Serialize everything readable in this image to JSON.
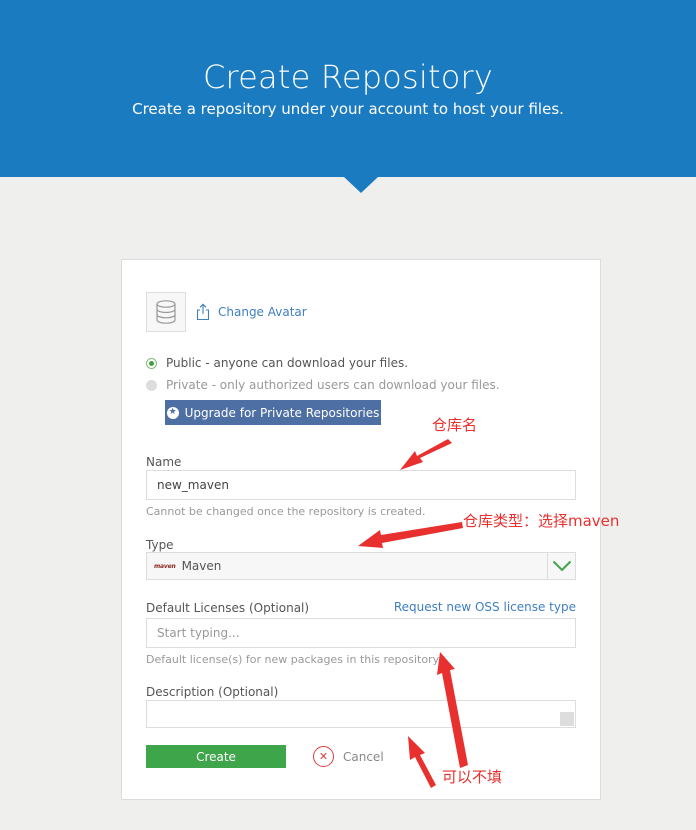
{
  "hero": {
    "title": "Create Repository",
    "subtitle": "Create a repository under your account to host your files."
  },
  "avatar": {
    "change_label": "Change Avatar"
  },
  "visibility": {
    "public_label": "Public - anyone can download your files.",
    "private_label": "Private - only authorized users can download your files.",
    "selected": "public",
    "upgrade_label": "Upgrade for Private Repositories"
  },
  "form": {
    "name_label": "Name",
    "name_value": "new_maven",
    "name_help": "Cannot be changed once the repository is created.",
    "type_label": "Type",
    "type_logo_text": "maven",
    "type_value": "Maven",
    "licenses_label": "Default Licenses (Optional)",
    "licenses_link": "Request new OSS license type",
    "licenses_placeholder": "Start typing...",
    "licenses_help": "Default license(s) for new packages in this repository.",
    "description_label": "Description (Optional)",
    "description_value": ""
  },
  "actions": {
    "create_label": "Create",
    "cancel_label": "Cancel"
  },
  "annotations": {
    "repo_name": "仓库名",
    "repo_type": "仓库类型：选择maven",
    "optional": "可以不填"
  },
  "colors": {
    "header_blue": "#1b7bc1",
    "create_green": "#3ea54a",
    "upgrade_blue": "#4e6fa3",
    "annotation_red": "#e8312f",
    "link_blue": "#3f7fbf"
  },
  "icons": {
    "avatar": "database-icon",
    "change_avatar": "upload-icon",
    "upgrade": "star-icon",
    "dropdown": "chevron-down-icon",
    "cancel": "close-icon"
  }
}
